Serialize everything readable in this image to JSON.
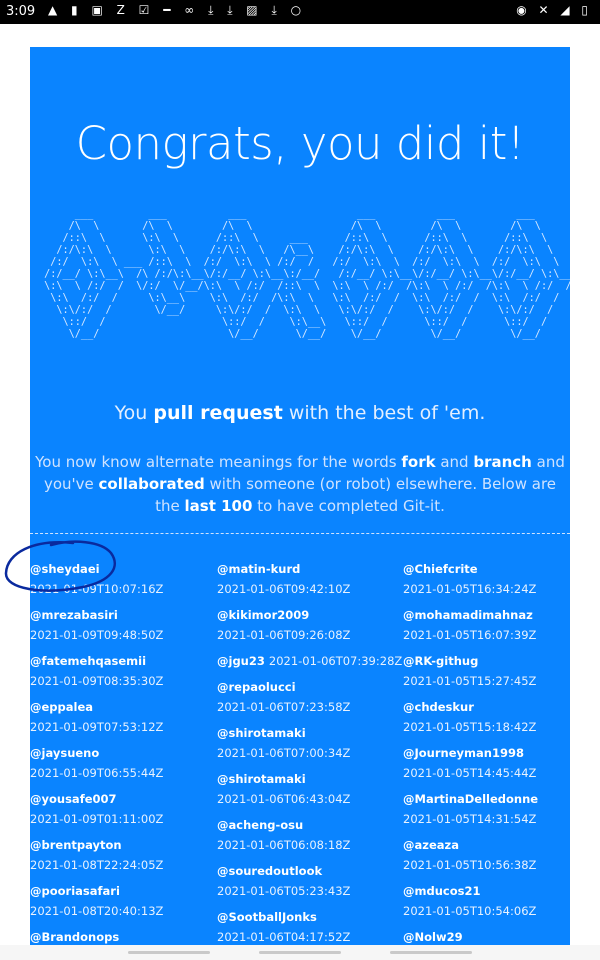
{
  "status_bar": {
    "time": "3:09",
    "left_icons": "▲ ▮ ▣ Z ☑ ━ ∞ ⤓ ⤓ ▨ ⤓ ○",
    "right_icons": "◉ ✕ ◢ ▯"
  },
  "page": {
    "headline": "Congrats, you did it!",
    "ascii_art": "      ___         ___          ___                  ___          ___          ___\n     /\\  \\       /\\  \\        /\\  \\                /\\  \\        /\\  \\        /\\  \\\n    /::\\  \\      \\:\\  \\      /::\\  \\     ___      /::\\  \\      /::\\  \\      /::\\  \\\n   /:/\\:\\  \\      \\:\\  \\    /:/\\:\\  \\   /\\__\\    /:/\\:\\  \\    /:/\\:\\  \\    /:/\\:\\  \\\n  /:/  \\:\\  \\ ___ /::\\  \\  /:/  \\:\\  \\ /:/  /   /:/  \\:\\  \\  /:/  \\:\\  \\  /:/  \\:\\  \\\n /:/__/ \\:\\__\\  /\\ /:/\\:\\__\\/:/__/ \\:\\__\\:/__/   /:/__/ \\:\\__\\/:/__/ \\:\\__\\/:/__/ \\:\\__\\\n \\:\\  \\ /:/  /  \\/:/  \\/__/\\:\\  \\ /:/  /::\\  \\  \\:\\  \\ /:/  /\\:\\  \\ /:/  /\\:\\  \\ /:/  /\n  \\:\\  /:/  /     \\:\\__\\    \\:\\  /:/  /\\:\\  \\   \\:\\  /:/  /  \\:\\  /:/  /  \\:\\  /:/  /\n   \\:\\/:/  /       \\/__/     \\:\\/:/  /  \\:\\  \\   \\:\\/:/  /    \\:\\/:/  /    \\:\\/:/  /\n    \\::/  /                   \\::/  /    \\:\\__\\   \\::/  /      \\::/  /      \\::/  /\n     \\/__/                     \\/__/      \\/__/    \\/__/        \\/__/        \\/__/",
    "tagline": {
      "pre": "You ",
      "bold": "pull request",
      "post": " with the best of 'em."
    },
    "intro": {
      "t1": "You now know alternate meanings for the words ",
      "b1": "fork",
      "t2": " and ",
      "b2": "branch",
      "t3": " and you've ",
      "b3": "collaborated",
      "t4": " with someone (or robot) elsewhere. Below are the ",
      "b4": "last 100",
      "t5": " to have completed Git-it."
    }
  },
  "completers": {
    "col1": [
      {
        "name": "@sheydaei",
        "date": "2021-01-09T10:07:16Z"
      },
      {
        "name": "@mrezabasiri",
        "date": "2021-01-09T09:48:50Z"
      },
      {
        "name": "@fatemehqasemii",
        "date": "2021-01-09T08:35:30Z"
      },
      {
        "name": "@eppalea",
        "date": "2021-01-09T07:53:12Z"
      },
      {
        "name": "@jaysueno",
        "date": "2021-01-09T06:55:44Z"
      },
      {
        "name": "@yousafe007",
        "date": "2021-01-09T01:11:00Z"
      },
      {
        "name": "@brentpayton",
        "date": "2021-01-08T22:24:05Z"
      },
      {
        "name": "@pooriasafari",
        "date": "2021-01-08T20:40:13Z"
      },
      {
        "name": "@Brandonops",
        "date": ""
      }
    ],
    "col2": [
      {
        "name": "@matin-kurd",
        "date": "2021-01-06T09:42:10Z"
      },
      {
        "name": "@kikimor2009",
        "date": "2021-01-06T09:26:08Z"
      },
      {
        "name": "@jgu23",
        "date": "2021-01-06T07:39:28Z"
      },
      {
        "name": "@repaolucci",
        "date": "2021-01-06T07:23:58Z"
      },
      {
        "name": "@shirotamaki",
        "date": "2021-01-06T07:00:34Z"
      },
      {
        "name": "@shirotamaki",
        "date": "2021-01-06T06:43:04Z"
      },
      {
        "name": "@acheng-osu",
        "date": "2021-01-06T06:08:18Z"
      },
      {
        "name": "@souredoutlook",
        "date": "2021-01-06T05:23:43Z"
      },
      {
        "name": "@SootballJonks",
        "date": "2021-01-06T04:17:52Z"
      }
    ],
    "col3": [
      {
        "name": "@Chiefcrite",
        "date": "2021-01-05T16:34:24Z"
      },
      {
        "name": "@mohamadimahnaz",
        "date": "2021-01-05T16:07:39Z"
      },
      {
        "name": "@RK-githug",
        "date": "2021-01-05T15:27:45Z"
      },
      {
        "name": "@chdeskur",
        "date": "2021-01-05T15:18:42Z"
      },
      {
        "name": "@Journeyman1998",
        "date": "2021-01-05T14:45:44Z"
      },
      {
        "name": "@MartinaDelledonne",
        "date": "2021-01-05T14:31:54Z"
      },
      {
        "name": "@azeaza",
        "date": "2021-01-05T10:56:38Z"
      },
      {
        "name": "@mducos21",
        "date": "2021-01-05T10:54:06Z"
      },
      {
        "name": "@Nolw29",
        "date": ""
      }
    ]
  },
  "colors": {
    "card_background": "#0a84ff",
    "annotation_ink": "#0a2a9e"
  }
}
